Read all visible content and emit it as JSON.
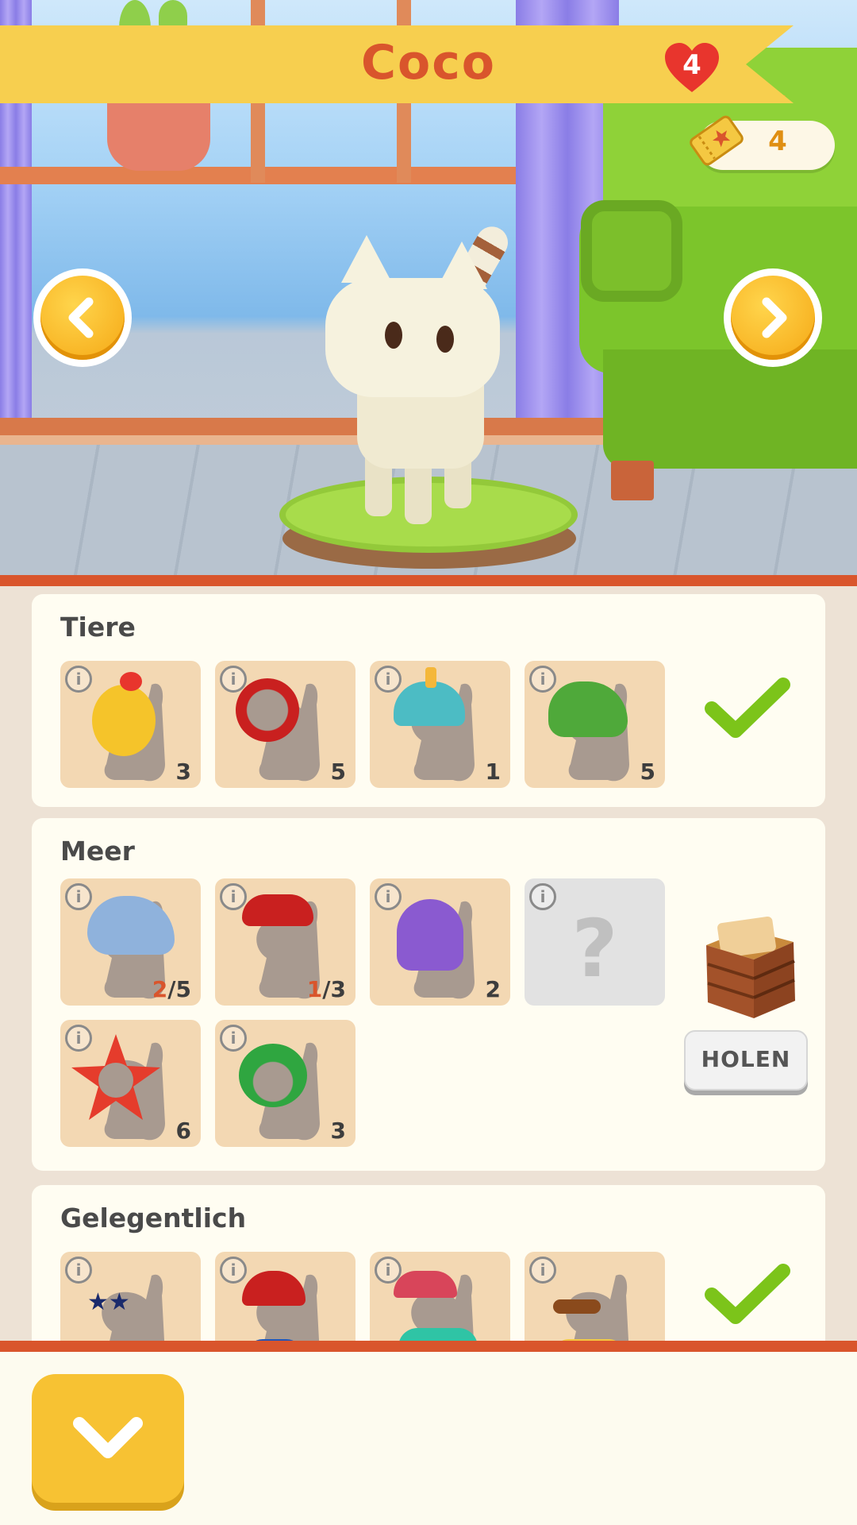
{
  "header": {
    "pet_name": "Coco",
    "hearts": "4",
    "tickets": "4"
  },
  "categories": [
    {
      "title": "Tiere",
      "status": "check-icon",
      "items": [
        {
          "costume": "chicken",
          "count": "3"
        },
        {
          "costume": "lion",
          "count": "5"
        },
        {
          "costume": "unicorn",
          "count": "1"
        },
        {
          "costume": "dinosaur",
          "count": "5"
        }
      ]
    },
    {
      "title": "Meer",
      "status": "crate",
      "action_label": "HOLEN",
      "items": [
        {
          "costume": "shark",
          "have": "2",
          "need": "/5"
        },
        {
          "costume": "crab",
          "have": "1",
          "need": "/3"
        },
        {
          "costume": "octopus",
          "count": "2"
        },
        {
          "costume": "unknown",
          "count": "?"
        },
        {
          "costume": "starfish",
          "count": "6"
        },
        {
          "costume": "frog",
          "count": "3"
        }
      ]
    },
    {
      "title": "Gelegentlich",
      "status": "check-icon",
      "items": [
        {
          "costume": "star-glasses"
        },
        {
          "costume": "beanie-shirt"
        },
        {
          "costume": "cap-hoodie"
        },
        {
          "costume": "mustache"
        }
      ]
    }
  ],
  "info_glyph": "i",
  "colors": {
    "accent_red": "#d9552c",
    "banner_yellow": "#f7cf4f",
    "slot_tan": "#f3d8b3",
    "check_green": "#7cc41a"
  }
}
